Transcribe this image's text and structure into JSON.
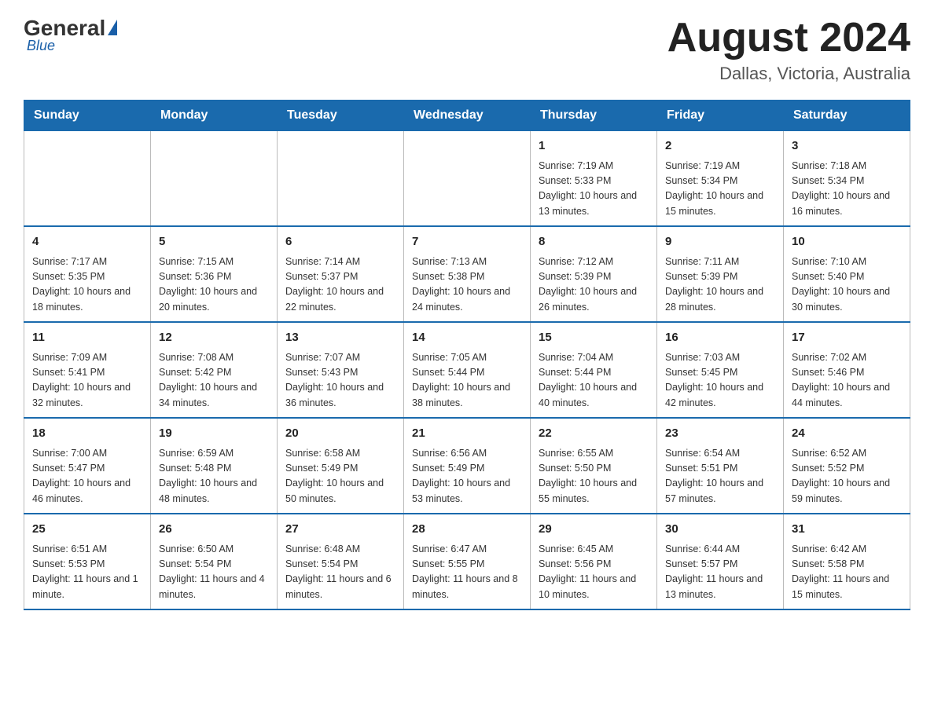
{
  "logo": {
    "general": "General",
    "blue": "Blue"
  },
  "title": "August 2024",
  "location": "Dallas, Victoria, Australia",
  "weekdays": [
    "Sunday",
    "Monday",
    "Tuesday",
    "Wednesday",
    "Thursday",
    "Friday",
    "Saturday"
  ],
  "weeks": [
    [
      {
        "day": "",
        "info": ""
      },
      {
        "day": "",
        "info": ""
      },
      {
        "day": "",
        "info": ""
      },
      {
        "day": "",
        "info": ""
      },
      {
        "day": "1",
        "info": "Sunrise: 7:19 AM\nSunset: 5:33 PM\nDaylight: 10 hours and 13 minutes."
      },
      {
        "day": "2",
        "info": "Sunrise: 7:19 AM\nSunset: 5:34 PM\nDaylight: 10 hours and 15 minutes."
      },
      {
        "day": "3",
        "info": "Sunrise: 7:18 AM\nSunset: 5:34 PM\nDaylight: 10 hours and 16 minutes."
      }
    ],
    [
      {
        "day": "4",
        "info": "Sunrise: 7:17 AM\nSunset: 5:35 PM\nDaylight: 10 hours and 18 minutes."
      },
      {
        "day": "5",
        "info": "Sunrise: 7:15 AM\nSunset: 5:36 PM\nDaylight: 10 hours and 20 minutes."
      },
      {
        "day": "6",
        "info": "Sunrise: 7:14 AM\nSunset: 5:37 PM\nDaylight: 10 hours and 22 minutes."
      },
      {
        "day": "7",
        "info": "Sunrise: 7:13 AM\nSunset: 5:38 PM\nDaylight: 10 hours and 24 minutes."
      },
      {
        "day": "8",
        "info": "Sunrise: 7:12 AM\nSunset: 5:39 PM\nDaylight: 10 hours and 26 minutes."
      },
      {
        "day": "9",
        "info": "Sunrise: 7:11 AM\nSunset: 5:39 PM\nDaylight: 10 hours and 28 minutes."
      },
      {
        "day": "10",
        "info": "Sunrise: 7:10 AM\nSunset: 5:40 PM\nDaylight: 10 hours and 30 minutes."
      }
    ],
    [
      {
        "day": "11",
        "info": "Sunrise: 7:09 AM\nSunset: 5:41 PM\nDaylight: 10 hours and 32 minutes."
      },
      {
        "day": "12",
        "info": "Sunrise: 7:08 AM\nSunset: 5:42 PM\nDaylight: 10 hours and 34 minutes."
      },
      {
        "day": "13",
        "info": "Sunrise: 7:07 AM\nSunset: 5:43 PM\nDaylight: 10 hours and 36 minutes."
      },
      {
        "day": "14",
        "info": "Sunrise: 7:05 AM\nSunset: 5:44 PM\nDaylight: 10 hours and 38 minutes."
      },
      {
        "day": "15",
        "info": "Sunrise: 7:04 AM\nSunset: 5:44 PM\nDaylight: 10 hours and 40 minutes."
      },
      {
        "day": "16",
        "info": "Sunrise: 7:03 AM\nSunset: 5:45 PM\nDaylight: 10 hours and 42 minutes."
      },
      {
        "day": "17",
        "info": "Sunrise: 7:02 AM\nSunset: 5:46 PM\nDaylight: 10 hours and 44 minutes."
      }
    ],
    [
      {
        "day": "18",
        "info": "Sunrise: 7:00 AM\nSunset: 5:47 PM\nDaylight: 10 hours and 46 minutes."
      },
      {
        "day": "19",
        "info": "Sunrise: 6:59 AM\nSunset: 5:48 PM\nDaylight: 10 hours and 48 minutes."
      },
      {
        "day": "20",
        "info": "Sunrise: 6:58 AM\nSunset: 5:49 PM\nDaylight: 10 hours and 50 minutes."
      },
      {
        "day": "21",
        "info": "Sunrise: 6:56 AM\nSunset: 5:49 PM\nDaylight: 10 hours and 53 minutes."
      },
      {
        "day": "22",
        "info": "Sunrise: 6:55 AM\nSunset: 5:50 PM\nDaylight: 10 hours and 55 minutes."
      },
      {
        "day": "23",
        "info": "Sunrise: 6:54 AM\nSunset: 5:51 PM\nDaylight: 10 hours and 57 minutes."
      },
      {
        "day": "24",
        "info": "Sunrise: 6:52 AM\nSunset: 5:52 PM\nDaylight: 10 hours and 59 minutes."
      }
    ],
    [
      {
        "day": "25",
        "info": "Sunrise: 6:51 AM\nSunset: 5:53 PM\nDaylight: 11 hours and 1 minute."
      },
      {
        "day": "26",
        "info": "Sunrise: 6:50 AM\nSunset: 5:54 PM\nDaylight: 11 hours and 4 minutes."
      },
      {
        "day": "27",
        "info": "Sunrise: 6:48 AM\nSunset: 5:54 PM\nDaylight: 11 hours and 6 minutes."
      },
      {
        "day": "28",
        "info": "Sunrise: 6:47 AM\nSunset: 5:55 PM\nDaylight: 11 hours and 8 minutes."
      },
      {
        "day": "29",
        "info": "Sunrise: 6:45 AM\nSunset: 5:56 PM\nDaylight: 11 hours and 10 minutes."
      },
      {
        "day": "30",
        "info": "Sunrise: 6:44 AM\nSunset: 5:57 PM\nDaylight: 11 hours and 13 minutes."
      },
      {
        "day": "31",
        "info": "Sunrise: 6:42 AM\nSunset: 5:58 PM\nDaylight: 11 hours and 15 minutes."
      }
    ]
  ]
}
